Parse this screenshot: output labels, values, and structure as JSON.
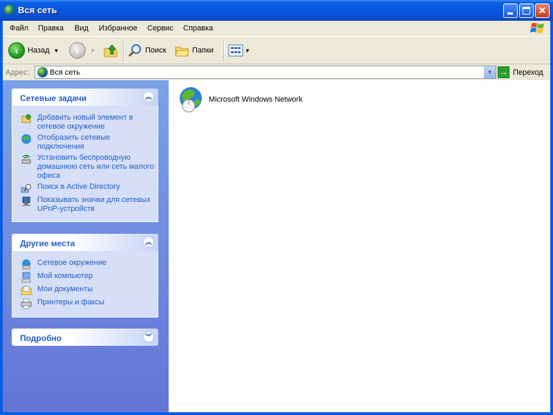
{
  "window": {
    "title": "Вся сеть"
  },
  "menu": {
    "items": [
      "Файл",
      "Правка",
      "Вид",
      "Избранное",
      "Сервис",
      "Справка"
    ]
  },
  "toolbar": {
    "back_label": "Назад",
    "search_label": "Поиск",
    "folders_label": "Папки"
  },
  "address": {
    "label": "Адрес:",
    "value": "Вся сеть",
    "go_label": "Переход"
  },
  "network_tasks": {
    "title": "Сетевые задачи",
    "items": [
      "Добавить новый элемент в сетевое окружение",
      "Отобразить сетевые подключения",
      "Установить беспроводную домашнюю сеть или сеть малого офиса",
      "Поиск в Active Directory",
      "Показывать значки для сетевых UPnP-устройств"
    ]
  },
  "other_places": {
    "title": "Другие места",
    "items": [
      "Сетевое окружение",
      "Мой компьютер",
      "Мои документы",
      "Принтеры и факсы"
    ]
  },
  "details": {
    "title": "Подробно"
  },
  "content": {
    "items": [
      {
        "label": "Microsoft Windows Network",
        "icon": "network-globe-icon"
      }
    ]
  },
  "colors": {
    "title_bar": "#0756e0",
    "task_pane_gradient_top": "#7ba2e7",
    "task_link": "#215dc6"
  }
}
